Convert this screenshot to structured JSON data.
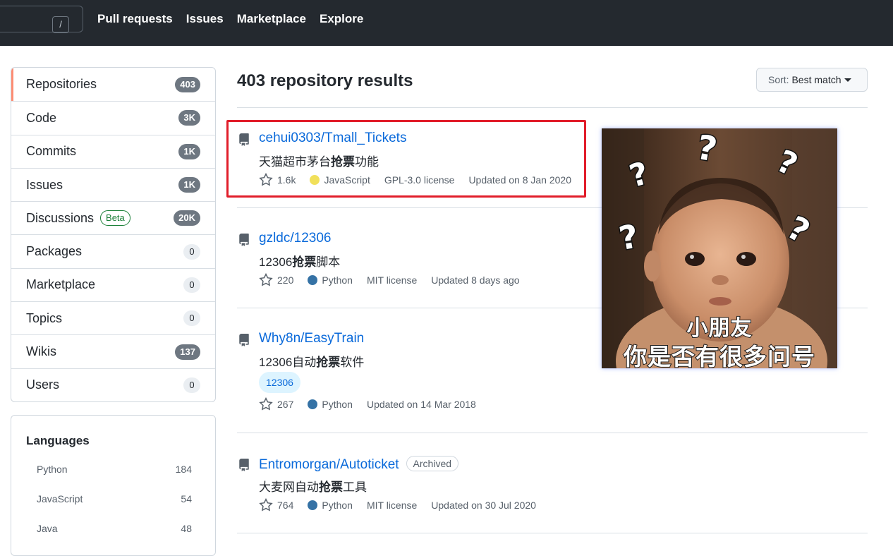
{
  "header": {
    "slash_key": "/",
    "nav": [
      "Pull requests",
      "Issues",
      "Marketplace",
      "Explore"
    ]
  },
  "sidebar": {
    "items": [
      {
        "label": "Repositories",
        "count": "403"
      },
      {
        "label": "Code",
        "count": "3K"
      },
      {
        "label": "Commits",
        "count": "1K"
      },
      {
        "label": "Issues",
        "count": "1K"
      },
      {
        "label": "Discussions",
        "badge": "Beta",
        "count": "20K"
      },
      {
        "label": "Packages",
        "count": "0"
      },
      {
        "label": "Marketplace",
        "count": "0"
      },
      {
        "label": "Topics",
        "count": "0"
      },
      {
        "label": "Wikis",
        "count": "137"
      },
      {
        "label": "Users",
        "count": "0"
      }
    ],
    "languages": {
      "title": "Languages",
      "items": [
        {
          "name": "Python",
          "count": "184"
        },
        {
          "name": "JavaScript",
          "count": "54"
        },
        {
          "name": "Java",
          "count": "48"
        }
      ]
    }
  },
  "main": {
    "title": "403 repository results",
    "sort": {
      "prefix": "Sort:",
      "value": "Best match"
    },
    "repos": [
      {
        "name": "cehui0303/Tmall_Tickets",
        "desc_pre": "天猫超市茅台",
        "desc_bold": "抢票",
        "desc_post": "功能",
        "stars": "1.6k",
        "language": "JavaScript",
        "language_color": "#f1e05a",
        "license": "GPL-3.0 license",
        "updated": "Updated on 8 Jan 2020"
      },
      {
        "name": "gzldc/12306",
        "desc_pre": "12306",
        "desc_bold": "抢票",
        "desc_post": "脚本",
        "stars": "220",
        "language": "Python",
        "language_color": "#3572A5",
        "license": "MIT license",
        "updated": "Updated 8 days ago"
      },
      {
        "name": "Why8n/EasyTrain",
        "desc_pre": "12306自动",
        "desc_bold": "抢票",
        "desc_post": "软件",
        "topic": "12306",
        "stars": "267",
        "language": "Python",
        "language_color": "#3572A5",
        "updated": "Updated on 14 Mar 2018"
      },
      {
        "name": "Entromorgan/Autoticket",
        "archived": "Archived",
        "desc_pre": "大麦网自动",
        "desc_bold": "抢票",
        "desc_post": "工具",
        "stars": "764",
        "language": "Python",
        "language_color": "#3572A5",
        "license": "MIT license",
        "updated": "Updated on 30 Jul 2020"
      }
    ]
  },
  "meme": {
    "line1": "小朋友",
    "line2": "你是否有很多问号"
  },
  "colors": {
    "header_bg": "#24292f",
    "link": "#0969da",
    "highlight_border": "#e11d2a",
    "selected_accent": "#fd8c73"
  }
}
